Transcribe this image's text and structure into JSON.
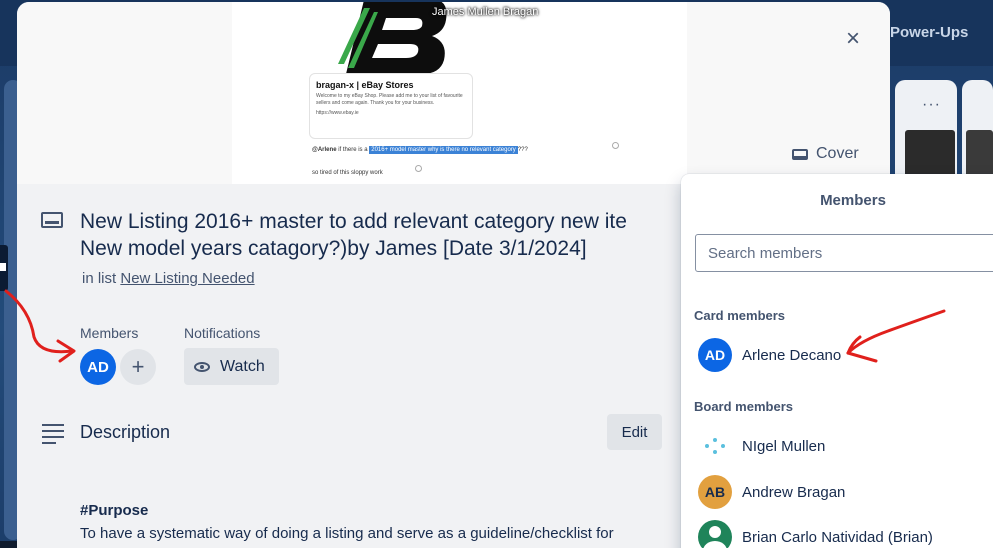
{
  "background": {
    "powerups_label": "Power-Ups",
    "list_menu": "···"
  },
  "overlay": {
    "viewer_name": "James Mullen Bragan"
  },
  "cover": {
    "store_title": "bragan-x | eBay Stores",
    "store_desc": "Welcome to my eBay Shop. Please add me to your list of favourite sellers and come again. Thank you for your business.",
    "store_url": "https://www.ebay.ie",
    "comment_mention": "@Arlene",
    "comment_pre": "if there is a",
    "comment_highlight": "2016+ model master why is there no relevant category",
    "comment_post": "???",
    "comment_2": "so tired of this sloppy work",
    "button_label": "Cover"
  },
  "card": {
    "close": "×",
    "title_line1": "New Listing 2016+ master to add relevant category new ite",
    "title_line2": "New model years catagory?)by James [Date 3/1/2024]",
    "in_list_prefix": "in list",
    "list_name": "New Listing Needed",
    "members_label": "Members",
    "member_initials": "AD",
    "add_member": "+",
    "notifications_label": "Notifications",
    "watch_label": "Watch",
    "description_label": "Description",
    "edit_label": "Edit",
    "purpose_heading": "#Purpose",
    "purpose_text": "To have a systematic way of doing a listing and serve as a guideline/checklist for"
  },
  "members_popover": {
    "title": "Members",
    "search_placeholder": "Search members",
    "card_members_label": "Card members",
    "card_members": [
      {
        "initials": "AD",
        "name": "Arlene Decano"
      }
    ],
    "board_members_label": "Board members",
    "board_members": [
      {
        "initials": "",
        "name": "NIgel Mullen"
      },
      {
        "initials": "AB",
        "name": "Andrew Bragan"
      },
      {
        "initials": "",
        "name": "Brian Carlo Natividad (Brian)"
      }
    ]
  },
  "colors": {
    "accent": "#0c66e4",
    "annotation_arrow": "#e0201c",
    "board_bg": "#1f3a63"
  }
}
